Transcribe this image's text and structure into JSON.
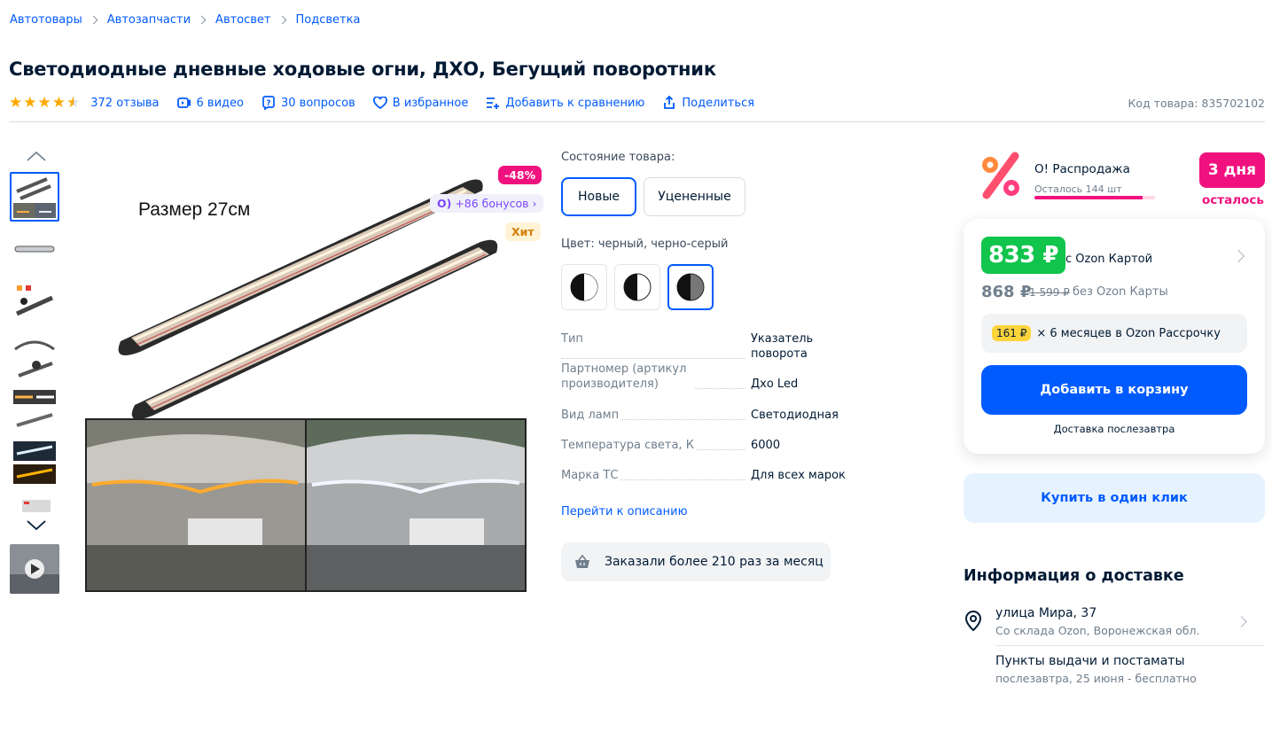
{
  "breadcrumbs": [
    "Автотовары",
    "Автозапчасти",
    "Автосвет",
    "Подсветка"
  ],
  "product": {
    "title": "Светодиодные дневные ходовые огни, ДХО, Бегущий поворотник",
    "rating": 4.5,
    "reviews": "372 отзыва",
    "videos": "6 видео",
    "questions": "30 вопросов",
    "favorite": "В избранное",
    "compare": "Добавить к сравнению",
    "share": "Поделиться",
    "code": "Код товара: 835702102"
  },
  "gallery": {
    "thumbnail_count": 8,
    "active_index": 0,
    "image_caption": "Размер 27см",
    "badges": {
      "discount": "-48%",
      "bonus": "+86 бонусов",
      "hit": "Хит"
    }
  },
  "condition": {
    "label": "Состояние товара:",
    "options": [
      "Новые",
      "Уцененные"
    ],
    "selected": "Новые"
  },
  "color": {
    "label": "Цвет: черный, черно-серый",
    "swatch_count": 3,
    "selected_index": 2
  },
  "specs": [
    {
      "key": "Тип",
      "value": "Указатель поворота"
    },
    {
      "key": "Партномер (артикул производителя)",
      "value": "Дхо Led"
    },
    {
      "key": "Вид ламп",
      "value": "Светодиодная"
    },
    {
      "key": "Температура света, К",
      "value": "6000"
    },
    {
      "key": "Марка ТС",
      "value": "Для всех марок"
    }
  ],
  "goto_description": "Перейти к описанию",
  "ordered_text": "Заказали более 210 раз за месяц",
  "sale": {
    "title": "О! Распродажа",
    "remaining": "Осталось 144 шт",
    "remaining_fraction": 0.9,
    "days": "3 дня",
    "days_label": "осталось"
  },
  "pricing": {
    "card_price": "833 ₽",
    "card_note": "с Ozon Картой",
    "price": "868 ₽",
    "old_price": "1 599 ₽",
    "no_card_note": "без Ozon Карты",
    "installment_amount": "161 ₽",
    "installment_text": "× 6 месяцев в Ozon Рассрочку",
    "add_to_cart": "Добавить в корзину",
    "delivery_note": "Доставка послезавтра",
    "one_click": "Купить в один клик"
  },
  "delivery": {
    "title": "Информация о доставке",
    "address": "улица Мира, 37",
    "warehouse": "Со склада Ozon, Воронежская обл.",
    "pickup_title": "Пункты выдачи и постаматы",
    "pickup_note": "послезавтра, 25 июня - бесплатно"
  },
  "colors": {
    "accent": "#005bff",
    "sale_pink": "#f1117e",
    "price_green": "#10c44c",
    "star": "#ffa800",
    "text": "#001a34"
  }
}
